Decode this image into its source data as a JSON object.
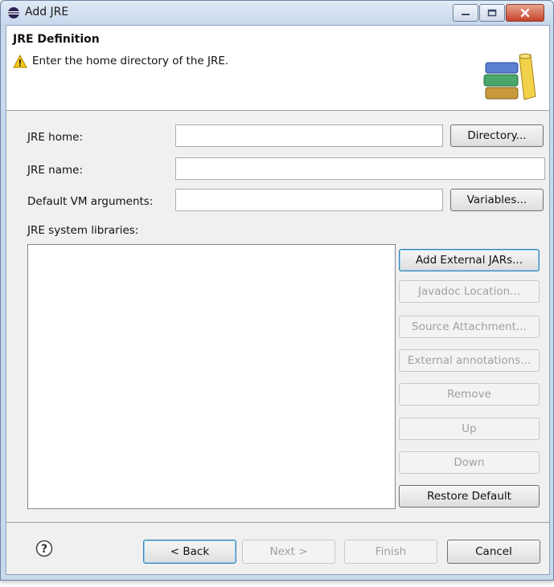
{
  "window": {
    "title": "Add JRE"
  },
  "header": {
    "title": "JRE Definition",
    "message": "Enter the home directory of the JRE.",
    "banner_icon": "jre-library-books-icon"
  },
  "form": {
    "jre_home": {
      "label": "JRE home:",
      "value": "",
      "button": "Directory..."
    },
    "jre_name": {
      "label": "JRE name:",
      "value": ""
    },
    "vm_args": {
      "label": "Default VM arguments:",
      "value": "",
      "button": "Variables..."
    },
    "libraries_label": "JRE system libraries:"
  },
  "library_buttons": [
    {
      "label": "Add External JARs...",
      "enabled": true
    },
    {
      "label": "Javadoc Location...",
      "enabled": false
    },
    {
      "label": "Source Attachment...",
      "enabled": false
    },
    {
      "label": "External annotations...",
      "enabled": false
    },
    {
      "label": "Remove",
      "enabled": false
    },
    {
      "label": "Up",
      "enabled": false
    },
    {
      "label": "Down",
      "enabled": false
    },
    {
      "label": "Restore Default",
      "enabled": true
    }
  ],
  "footer": {
    "back": "< Back",
    "next": "Next >",
    "finish": "Finish",
    "cancel": "Cancel"
  }
}
